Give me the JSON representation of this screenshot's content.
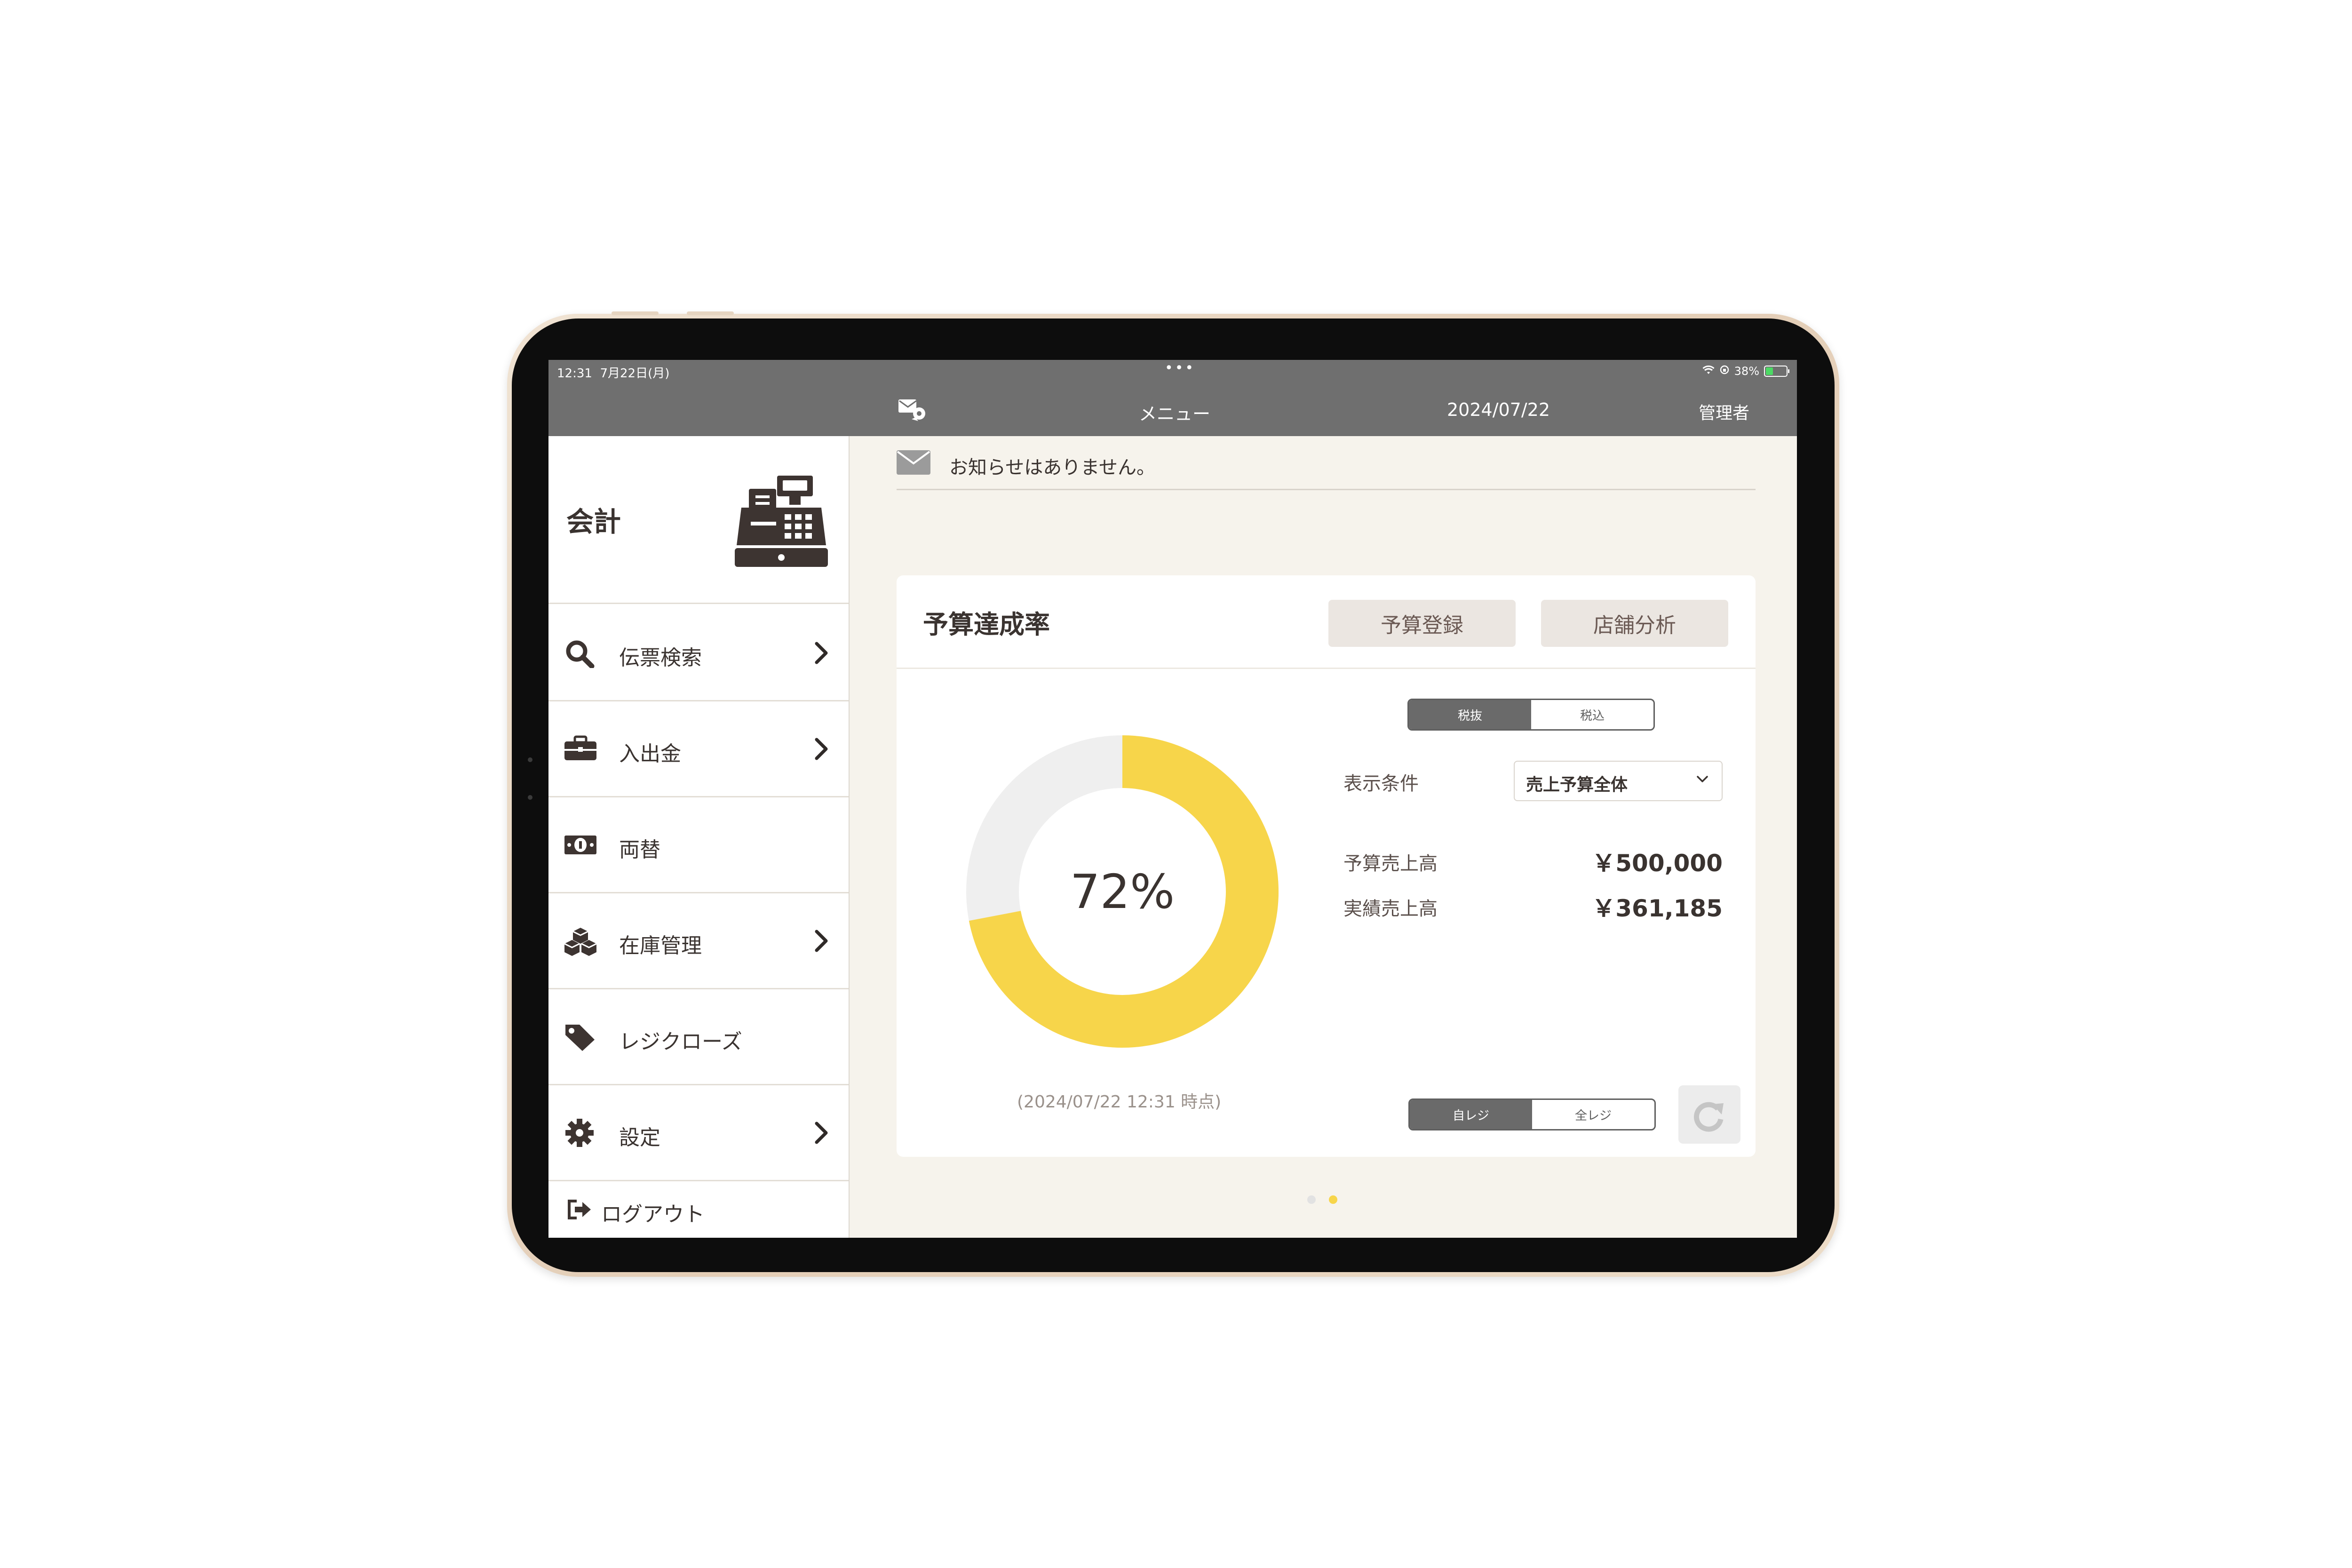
{
  "status_bar": {
    "time": "12:31",
    "date": "7月22日(月)",
    "dots": "•••",
    "battery_percent": "38%",
    "battery_level": 0.38
  },
  "nav": {
    "title": "メニュー",
    "date": "2024/07/22",
    "user": "管理者"
  },
  "sidebar": {
    "title": "会計",
    "items": [
      {
        "label": "伝票検索",
        "icon": "search-icon"
      },
      {
        "label": "入出金",
        "icon": "briefcase-icon"
      },
      {
        "label": "両替",
        "icon": "banknote-icon"
      },
      {
        "label": "在庫管理",
        "icon": "boxes-icon"
      },
      {
        "label": "レジクローズ",
        "icon": "tag-icon"
      },
      {
        "label": "設定",
        "icon": "gear-icon"
      }
    ],
    "logout": "ログアウト"
  },
  "notice": {
    "text": "お知らせはありません。"
  },
  "budget_card": {
    "title": "予算達成率",
    "register_btn": "予算登録",
    "analysis_btn": "店舗分析",
    "tax_toggle": [
      "税抜",
      "税込"
    ],
    "tax_selected": "税抜",
    "condition_label": "表示条件",
    "condition_value": "売上予算全体",
    "budget_label": "予算売上高",
    "budget_value": "￥500,000",
    "actual_label": "実績売上高",
    "actual_value": "￥361,185",
    "percent_text": "72%",
    "percent": 72,
    "timestamp": "(2024/07/22 12:31 時点)",
    "register_toggle": [
      "自レジ",
      "全レジ"
    ],
    "register_selected": "自レジ"
  },
  "pager": {
    "pages": 2,
    "current": 2
  },
  "colors": {
    "bar_gray": "#6f6f6f",
    "accent_yellow": "#f7d54a",
    "donut_track": "#efefef",
    "background": "#f6f3ec"
  }
}
